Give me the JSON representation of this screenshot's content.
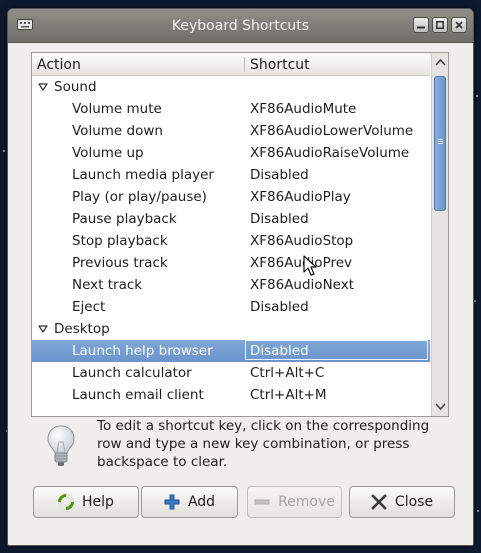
{
  "window": {
    "title": "Keyboard Shortcuts"
  },
  "table": {
    "columns": {
      "action": "Action",
      "shortcut": "Shortcut"
    },
    "rows": [
      {
        "kind": "group",
        "action": "Sound",
        "shortcut": ""
      },
      {
        "kind": "item",
        "action": "Volume mute",
        "shortcut": "XF86AudioMute"
      },
      {
        "kind": "item",
        "action": "Volume down",
        "shortcut": "XF86AudioLowerVolume"
      },
      {
        "kind": "item",
        "action": "Volume up",
        "shortcut": "XF86AudioRaiseVolume"
      },
      {
        "kind": "item",
        "action": "Launch media player",
        "shortcut": "Disabled"
      },
      {
        "kind": "item",
        "action": "Play (or play/pause)",
        "shortcut": "XF86AudioPlay"
      },
      {
        "kind": "item",
        "action": "Pause playback",
        "shortcut": "Disabled"
      },
      {
        "kind": "item",
        "action": "Stop playback",
        "shortcut": "XF86AudioStop"
      },
      {
        "kind": "item",
        "action": "Previous track",
        "shortcut": "XF86AudioPrev"
      },
      {
        "kind": "item",
        "action": "Next track",
        "shortcut": "XF86AudioNext"
      },
      {
        "kind": "item",
        "action": "Eject",
        "shortcut": "Disabled"
      },
      {
        "kind": "group",
        "action": "Desktop",
        "shortcut": ""
      },
      {
        "kind": "item",
        "action": "Launch help browser",
        "shortcut": "Disabled",
        "selected": true
      },
      {
        "kind": "item",
        "action": "Launch calculator",
        "shortcut": "Ctrl+Alt+C"
      },
      {
        "kind": "item",
        "action": "Launch email client",
        "shortcut": "Ctrl+Alt+M"
      }
    ]
  },
  "hint": {
    "text": "To edit a shortcut key, click on the corresponding row and type a new key combination, or press backspace to clear."
  },
  "buttons": {
    "help": "Help",
    "add": "Add",
    "remove": "Remove",
    "close": "Close"
  },
  "icons": {
    "app": "keyboard-icon",
    "hint": "lightbulb-icon",
    "help": "lifebuoy-icon",
    "add": "plus-icon",
    "remove": "minus-icon",
    "close": "x-icon"
  },
  "colors": {
    "selection": "#6f97cd",
    "scroll_thumb": "#7aa0d0",
    "add_icon": "#3d78c4"
  }
}
